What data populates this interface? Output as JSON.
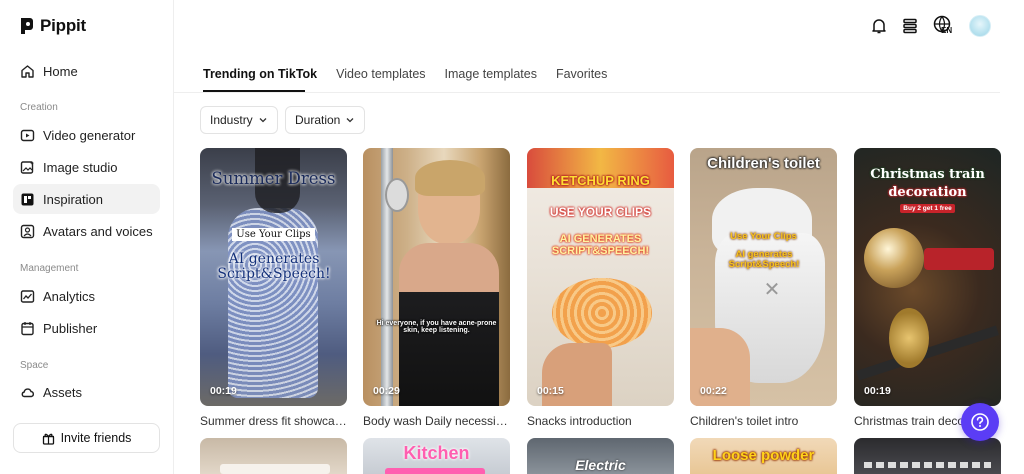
{
  "app": {
    "name": "Pippit"
  },
  "sidebar": {
    "home": "Home",
    "sections": [
      {
        "label": "Creation"
      },
      {
        "label": "Management"
      },
      {
        "label": "Space"
      }
    ],
    "creation": [
      "Video generator",
      "Image studio",
      "Inspiration",
      "Avatars and voices"
    ],
    "management": [
      "Analytics",
      "Publisher"
    ],
    "space": [
      "Assets"
    ],
    "invite": "Invite friends"
  },
  "header": {
    "lang": "EN"
  },
  "tabs": [
    "Trending on TikTok",
    "Video templates",
    "Image templates",
    "Favorites"
  ],
  "filters": [
    "Industry",
    "Duration"
  ],
  "cards": [
    {
      "caption": "Summer dress fit showcase",
      "duration": "00:19",
      "ov1": "Summer Dress",
      "ov2": "Use Your Clips",
      "ov3": "AI generates Script&Speech!"
    },
    {
      "caption": "Body wash Daily necessiti...",
      "duration": "00:29",
      "sub": "Hi everyone, if you have acne-prone skin, keep listening."
    },
    {
      "caption": "Snacks introduction",
      "duration": "00:15",
      "ov1": "KETCHUP RING",
      "ov2": "USE YOUR CLIPS",
      "ov3": "AI GENERATES SCRIPT&SPEECH!"
    },
    {
      "caption": "Children's toilet intro",
      "duration": "00:22",
      "ov1": "Children's toilet",
      "ov2": "Use Your Clips",
      "ov3": "AI generates Script&Speech!"
    },
    {
      "caption": "Christmas train deco",
      "duration": "00:19",
      "ov1": "Christmas train",
      "ov2": "decoration",
      "ov3": "Buy 2 get 1 free"
    }
  ],
  "row2": [
    {
      "text": ""
    },
    {
      "text": "Kitchen"
    },
    {
      "text": "Electric"
    },
    {
      "text": "Loose powder"
    },
    {
      "text": ""
    }
  ],
  "colors": {
    "accent": "#5b3df5",
    "active_bg": "#f2f2f2"
  }
}
